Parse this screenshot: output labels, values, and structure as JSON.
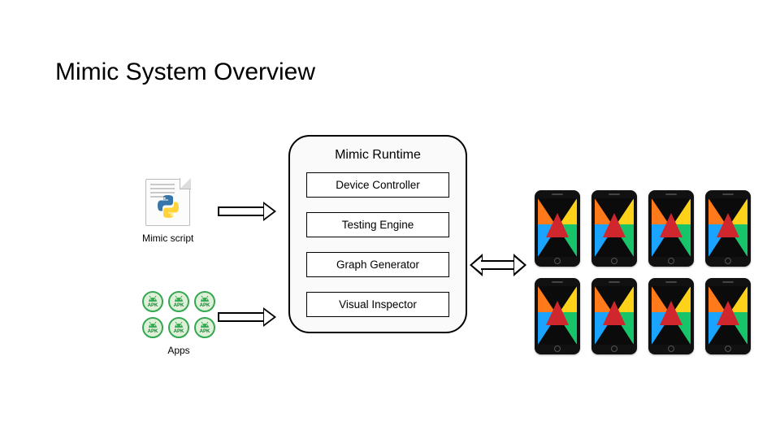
{
  "title": "Mimic System Overview",
  "inputs": {
    "script_label": "Mimic script",
    "apps_label": "Apps",
    "apk_badge": "APK"
  },
  "runtime": {
    "title": "Mimic Runtime",
    "modules": [
      "Device Controller",
      "Testing Engine",
      "Graph Generator",
      "Visual Inspector"
    ]
  },
  "devices": {
    "count": 8
  }
}
